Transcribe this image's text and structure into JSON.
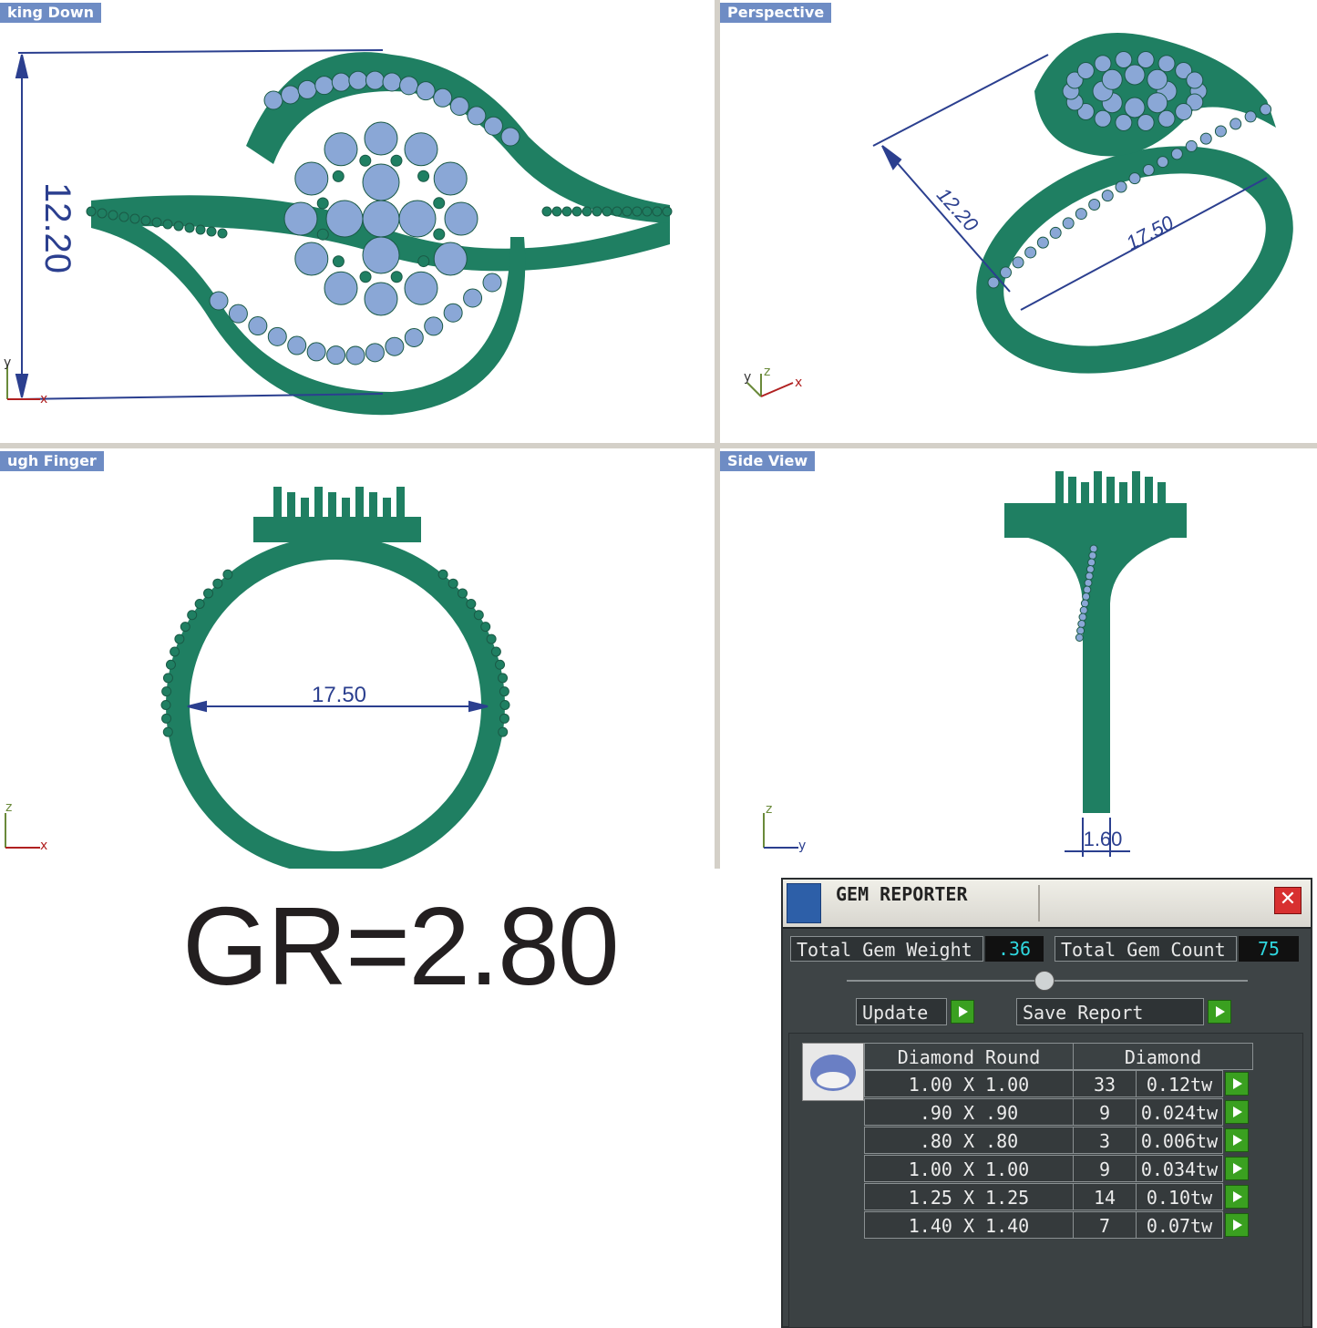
{
  "viewports": [
    {
      "id": "top",
      "label": "king Down",
      "dimension": "12.20",
      "axes": [
        "y",
        "x"
      ]
    },
    {
      "id": "perspective",
      "label": "Perspective",
      "dimensions": [
        "12.20",
        "17.50"
      ],
      "axes": [
        "y",
        "z",
        "x"
      ]
    },
    {
      "id": "front",
      "label": "ugh Finger",
      "dimension": "17.50",
      "axes": [
        "z",
        "x"
      ]
    },
    {
      "id": "side",
      "label": "Side View",
      "dimension": "1.60",
      "axes": [
        "z",
        "y"
      ]
    }
  ],
  "gr_text": "GR=2.80",
  "gem_reporter": {
    "title": "GEM REPORTER",
    "close_label": "✕",
    "total_weight_label": "Total Gem Weight",
    "total_weight_value": ".36",
    "total_count_label": "Total Gem Count",
    "total_count_value": "75",
    "update_label": "Update",
    "save_label": "Save Report",
    "table": {
      "headers": [
        "Diamond Round",
        "Diamond"
      ],
      "rows": [
        {
          "size": "1.00 X 1.00",
          "count": "33",
          "weight": "0.12tw"
        },
        {
          "size": ".90 X .90",
          "count": "9",
          "weight": "0.024tw"
        },
        {
          "size": ".80 X .80",
          "count": "3",
          "weight": "0.006tw"
        },
        {
          "size": "1.00 X 1.00",
          "count": "9",
          "weight": "0.034tw"
        },
        {
          "size": "1.25 X 1.25",
          "count": "14",
          "weight": "0.10tw"
        },
        {
          "size": "1.40 X 1.40",
          "count": "7",
          "weight": "0.07tw"
        }
      ]
    }
  },
  "colors": {
    "metal": "#1f7f62",
    "metal_light": "#2a9a78",
    "gem": "#8aa7d6",
    "dimension": "#2b3f8f",
    "label_bg": "#6e8cc4"
  }
}
